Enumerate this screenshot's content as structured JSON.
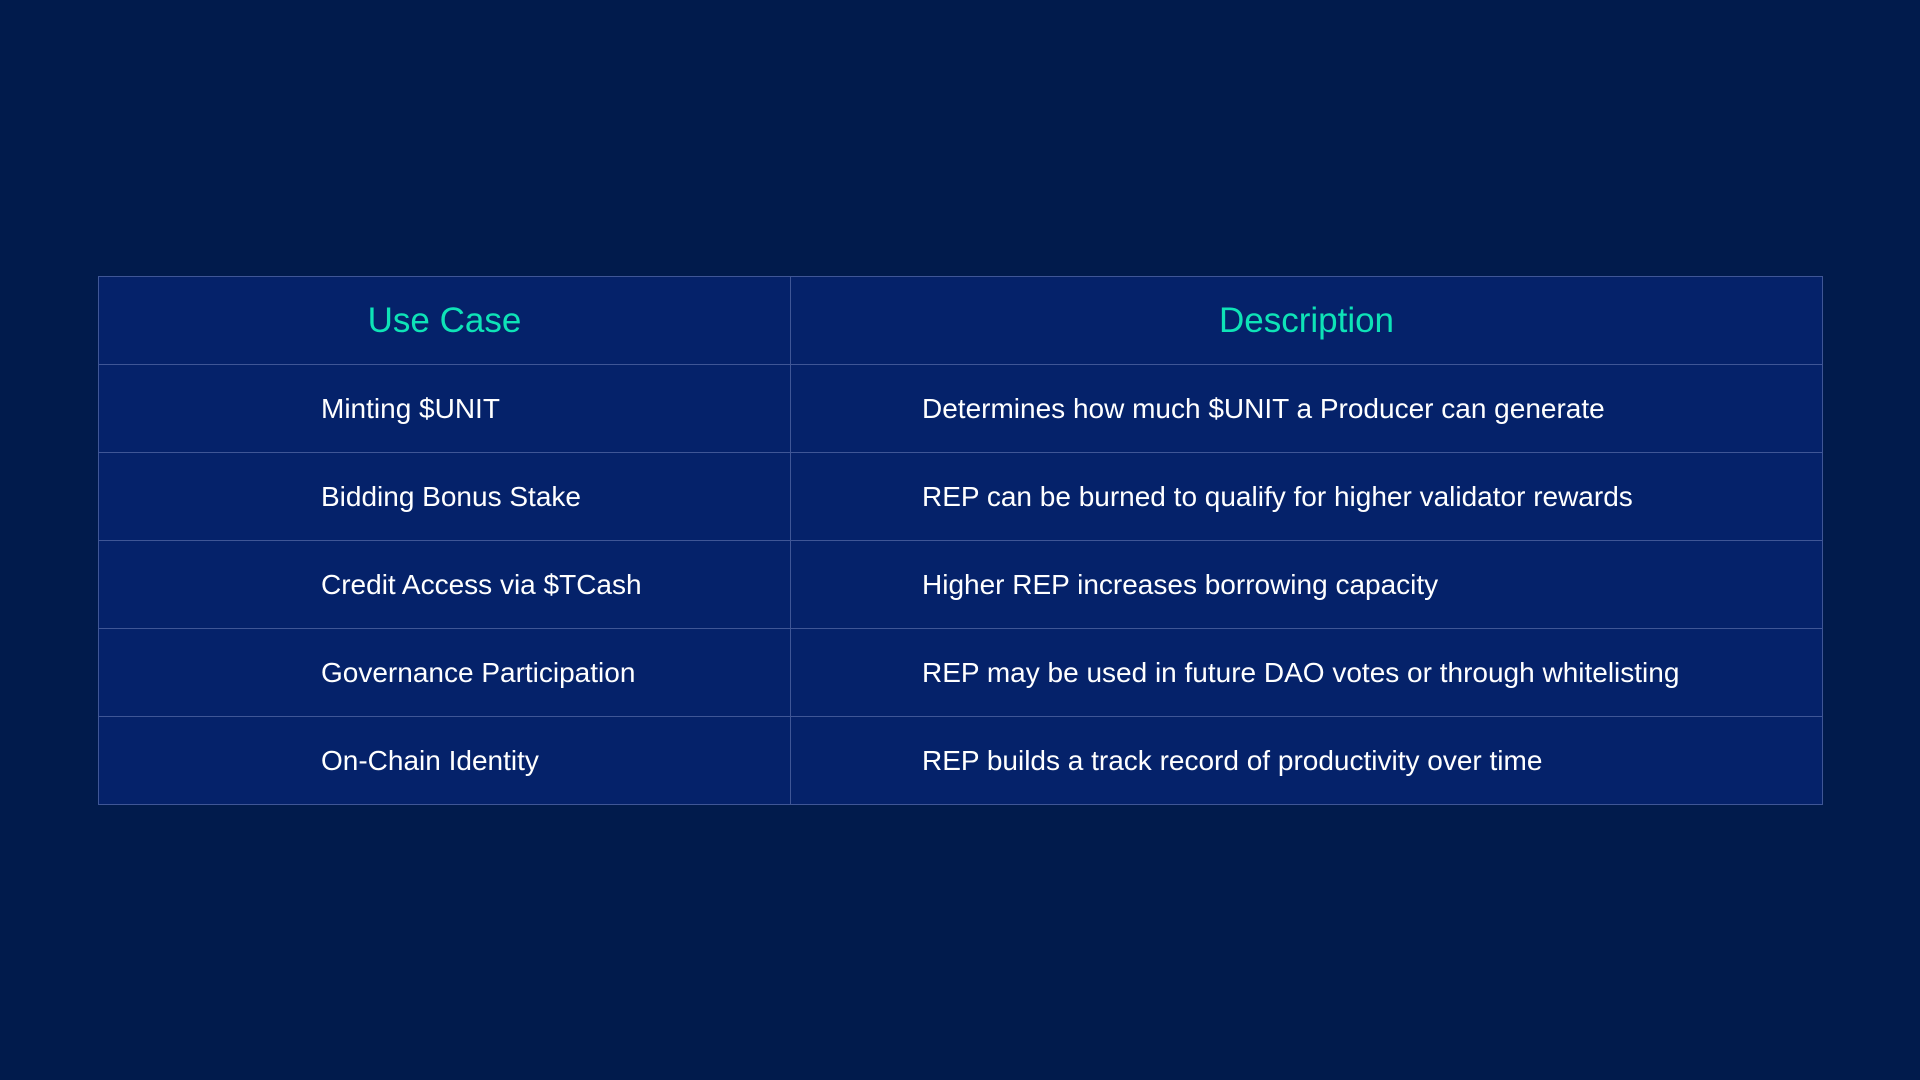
{
  "colors": {
    "background": "#011b4c",
    "table_bg": "#05226a",
    "header_text": "#0ee3b7",
    "body_text": "#ffffff",
    "border": "#3f5696"
  },
  "table": {
    "headers": [
      "Use Case",
      "Description"
    ],
    "rows": [
      [
        "Minting $UNIT",
        "Determines how much $UNIT a Producer can generate"
      ],
      [
        "Bidding Bonus Stake",
        "REP can be burned to qualify for higher validator rewards"
      ],
      [
        "Credit Access via $TCash",
        "Higher REP increases borrowing capacity"
      ],
      [
        "Governance Participation",
        "REP may be used in future DAO votes or through whitelisting"
      ],
      [
        "On-Chain Identity",
        "REP builds a track record of productivity over time"
      ]
    ]
  }
}
